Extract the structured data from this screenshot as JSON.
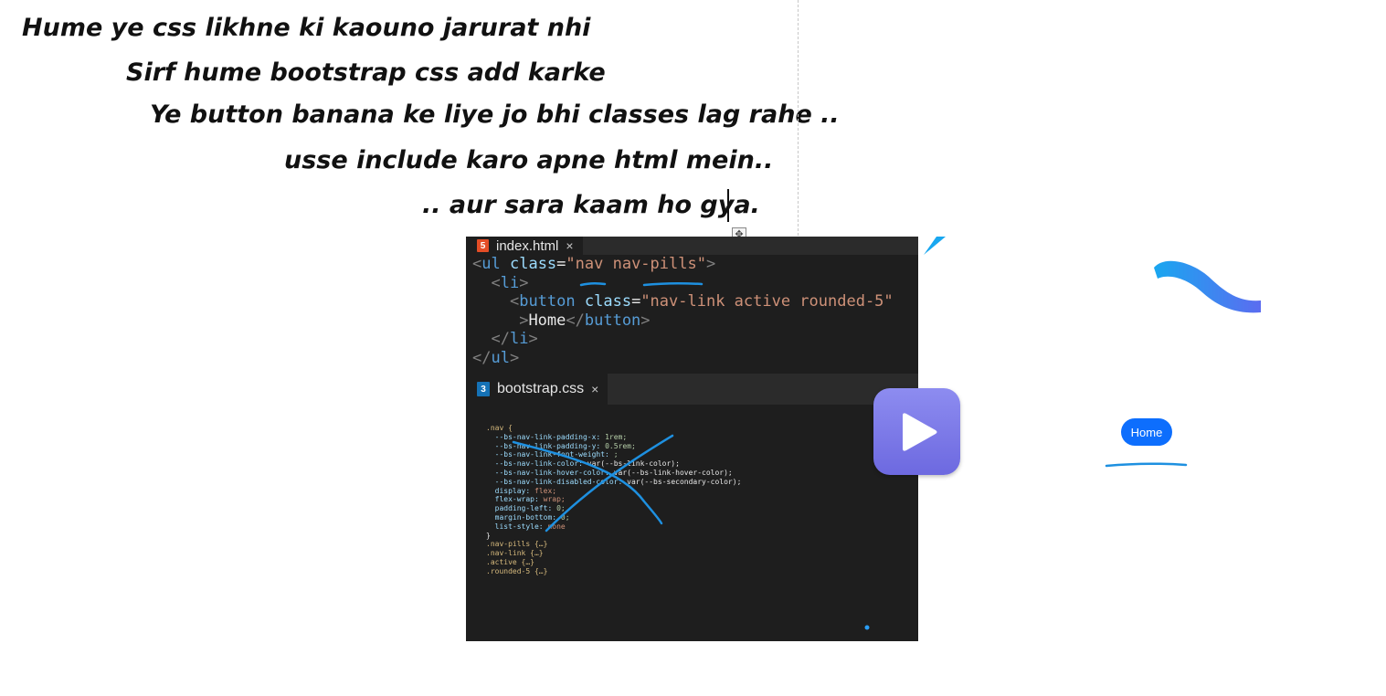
{
  "notes": {
    "line1": "Hume ye css likhne ki kaouno jarurat nhi",
    "line2": "Sirf hume bootstrap css add karke",
    "line3": "Ye button banana ke liye jo bhi classes lag rahe ..",
    "line4": "usse include karo apne html mein..",
    "line5": ".. aur sara kaam ho gya."
  },
  "editor": {
    "html_tab": {
      "label": "index.html",
      "icon": "html5-icon",
      "close": "×",
      "icon_text": "5"
    },
    "html_code": {
      "l1": {
        "open": "<",
        "tag": "ul",
        "attr": "class",
        "eq": "=",
        "val": "\"nav nav-pills\"",
        "close": ">"
      },
      "l2": {
        "open": "<",
        "tag": "li",
        "close": ">"
      },
      "l3": {
        "open": "<",
        "tag": "button",
        "attr": "class",
        "eq": "=",
        "val": "\"nav-link active rounded-5\""
      },
      "l4": {
        "gt": ">",
        "text": "Home",
        "open": "</",
        "tag": "button",
        "close": ">"
      },
      "l5": {
        "open": "</",
        "tag": "li",
        "close": ">"
      },
      "l6": {
        "open": "</",
        "tag": "ul",
        "close": ">"
      }
    },
    "css_tab": {
      "label": "bootstrap.css",
      "icon": "css3-icon",
      "close": "×",
      "icon_text": "3"
    },
    "css_code": {
      "rule1_selector": ".nav {",
      "props": [
        {
          "name": "--bs-nav-link-padding-x:",
          "value": "1rem;"
        },
        {
          "name": "--bs-nav-link-padding-y:",
          "value": "0.5rem;"
        },
        {
          "name": "--bs-nav-link-font-weight:",
          "value": ";"
        },
        {
          "name": "--bs-nav-link-color:",
          "value": "var(--bs-link-color);"
        },
        {
          "name": "--bs-nav-link-hover-color:",
          "value": "var(--bs-link-hover-color);"
        },
        {
          "name": "--bs-nav-link-disabled-color:",
          "value": "var(--bs-secondary-color);"
        },
        {
          "name": "display:",
          "value": "flex;"
        },
        {
          "name": "flex-wrap:",
          "value": "wrap;"
        },
        {
          "name": "padding-left:",
          "value": "0;"
        },
        {
          "name": "margin-bottom:",
          "value": "0;"
        },
        {
          "name": "list-style:",
          "value": "none"
        }
      ],
      "rule1_close": "}",
      "collapsed": [
        ".nav-pills {…}",
        ".nav-link {…}",
        ".active {…}",
        ".rounded-5 {…}"
      ]
    }
  },
  "preview": {
    "home_button": "Home",
    "play_icon": "play-icon",
    "accent": "#0d6efd",
    "play_color": "#7b78e8",
    "annotation_color": "#1e90e0"
  }
}
